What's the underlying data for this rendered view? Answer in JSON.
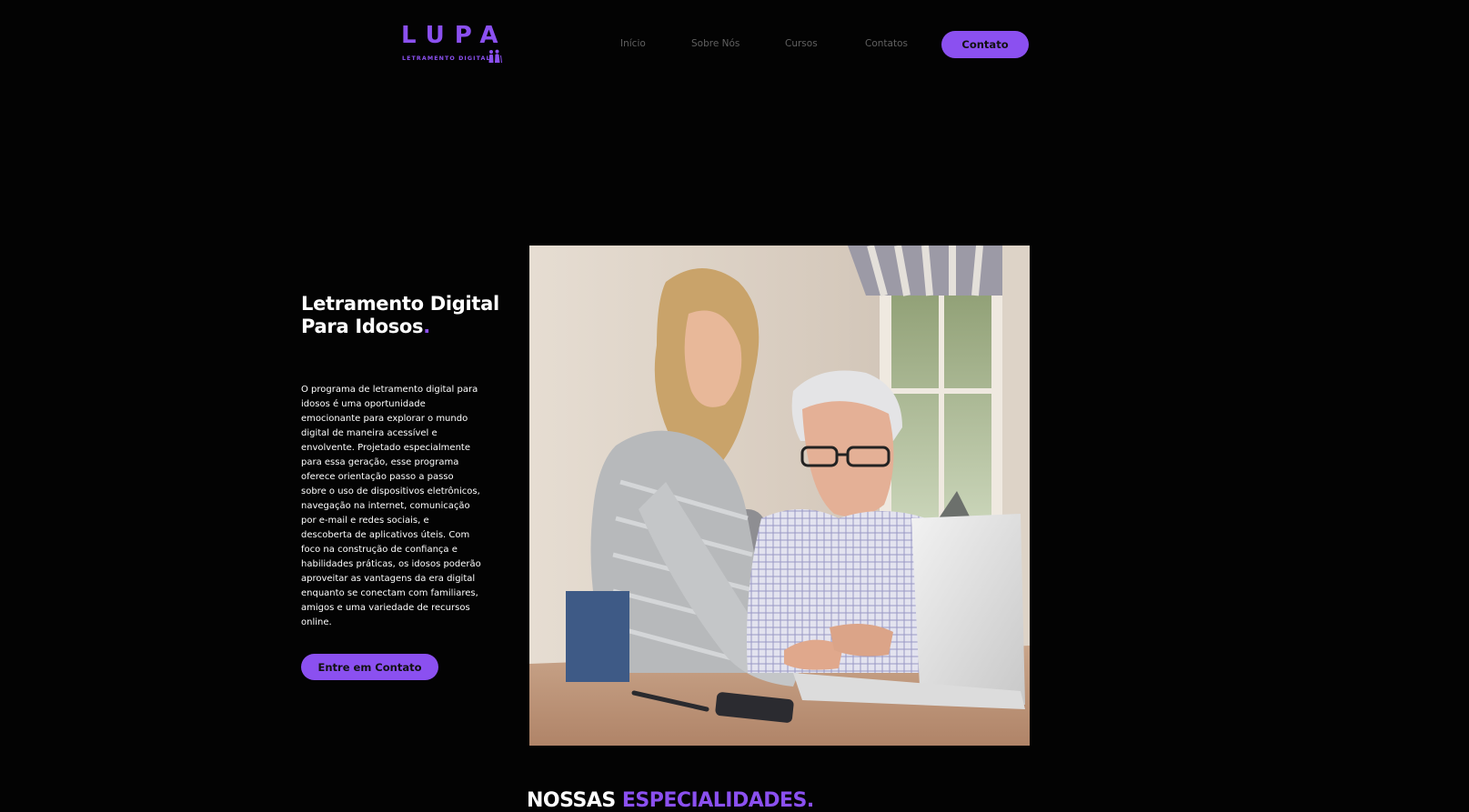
{
  "brand": {
    "name": "LUPA",
    "tagline": "LETRAMENTO DIGITAL",
    "accent_color": "#8b50f0",
    "icon": "elderly-couple-icon"
  },
  "nav": {
    "items": [
      {
        "label": "Início"
      },
      {
        "label": "Sobre Nós"
      },
      {
        "label": "Cursos"
      },
      {
        "label": "Contatos"
      }
    ],
    "cta_label": "Contato"
  },
  "hero": {
    "title": "Letramento Digital Para Idosos",
    "title_punctuation": ".",
    "description": "O programa de letramento digital para idosos é uma oportunidade emocionante para explorar o mundo digital de maneira acessível e envolvente. Projetado especialmente para essa geração, esse programa oferece orientação passo a passo sobre o uso de dispositivos eletrônicos, navegação na internet, comunicação por e-mail e redes sociais, e descoberta de aplicativos úteis. Com foco na construção de confiança e habilidades práticas, os idosos poderão aproveitar as vantagens da era digital enquanto se conectam com familiares, amigos e uma variedade de recursos online.",
    "cta_label": "Entre em Contato",
    "image": "photo-woman-helping-elderly-man-with-laptop"
  },
  "specialties": {
    "title_white": "NOSSAS",
    "title_accent": "ESPECIALIDADES."
  },
  "colors": {
    "background": "#030303",
    "accent": "#8b50f0",
    "nav_text": "#606060",
    "text": "#ffffff"
  }
}
